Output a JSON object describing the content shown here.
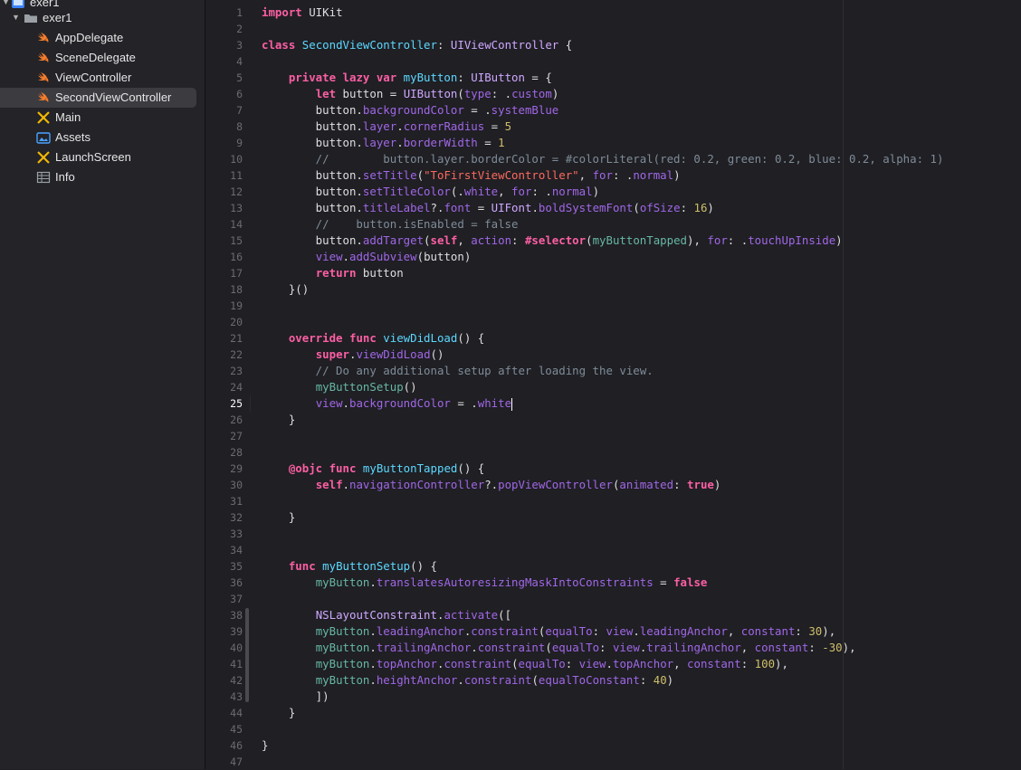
{
  "sidebar": {
    "items": [
      {
        "label": "exer1",
        "icon": "xcode-project-icon",
        "kind": "project"
      },
      {
        "label": "exer1",
        "icon": "folder-icon",
        "kind": "group"
      },
      {
        "label": "AppDelegate",
        "icon": "swift-file-icon"
      },
      {
        "label": "SceneDelegate",
        "icon": "swift-file-icon"
      },
      {
        "label": "ViewController",
        "icon": "swift-file-icon"
      },
      {
        "label": "SecondViewController",
        "icon": "swift-file-icon",
        "selected": true
      },
      {
        "label": "Main",
        "icon": "storyboard-icon"
      },
      {
        "label": "Assets",
        "icon": "asset-catalog-icon"
      },
      {
        "label": "LaunchScreen",
        "icon": "storyboard-icon"
      },
      {
        "label": "Info",
        "icon": "plist-icon"
      }
    ]
  },
  "editor": {
    "current_line": 25,
    "line_count": 47,
    "lines": [
      [
        [
          "kw",
          "import"
        ],
        [
          "pl",
          " UIKit"
        ]
      ],
      [],
      [
        [
          "kw",
          "class"
        ],
        [
          "pl",
          " "
        ],
        [
          "ty",
          "SecondViewController"
        ],
        [
          "pl",
          ": "
        ],
        [
          "tyd",
          "UIViewController"
        ],
        [
          "pl",
          " {"
        ]
      ],
      [],
      [
        [
          "pl",
          "    "
        ],
        [
          "kw",
          "private lazy var"
        ],
        [
          "pl",
          " "
        ],
        [
          "ty",
          "myButton"
        ],
        [
          "pl",
          ": "
        ],
        [
          "tyd",
          "UIButton"
        ],
        [
          "pl",
          " = {"
        ]
      ],
      [
        [
          "pl",
          "        "
        ],
        [
          "kw",
          "let"
        ],
        [
          "pl",
          " button = "
        ],
        [
          "tyd",
          "UIButton"
        ],
        [
          "pl",
          "("
        ],
        [
          "pr",
          "type"
        ],
        [
          "pl",
          ": ."
        ],
        [
          "pr",
          "custom"
        ],
        [
          "pl",
          ")"
        ]
      ],
      [
        [
          "pl",
          "        button."
        ],
        [
          "pr",
          "backgroundColor"
        ],
        [
          "pl",
          " = ."
        ],
        [
          "pr",
          "systemBlue"
        ]
      ],
      [
        [
          "pl",
          "        button."
        ],
        [
          "pr",
          "layer"
        ],
        [
          "pl",
          "."
        ],
        [
          "pr",
          "cornerRadius"
        ],
        [
          "pl",
          " = "
        ],
        [
          "num",
          "5"
        ]
      ],
      [
        [
          "pl",
          "        button."
        ],
        [
          "pr",
          "layer"
        ],
        [
          "pl",
          "."
        ],
        [
          "pr",
          "borderWidth"
        ],
        [
          "pl",
          " = "
        ],
        [
          "num",
          "1"
        ]
      ],
      [
        [
          "cm",
          "        //        button.layer.borderColor = #colorLiteral(red: 0.2, green: 0.2, blue: 0.2, alpha: 1)"
        ]
      ],
      [
        [
          "pl",
          "        button."
        ],
        [
          "pr",
          "setTitle"
        ],
        [
          "pl",
          "("
        ],
        [
          "str",
          "\"ToFirstViewController\""
        ],
        [
          "pl",
          ", "
        ],
        [
          "pr",
          "for"
        ],
        [
          "pl",
          ": ."
        ],
        [
          "pr",
          "normal"
        ],
        [
          "pl",
          ")"
        ]
      ],
      [
        [
          "pl",
          "        button."
        ],
        [
          "pr",
          "setTitleColor"
        ],
        [
          "pl",
          "(."
        ],
        [
          "pr",
          "white"
        ],
        [
          "pl",
          ", "
        ],
        [
          "pr",
          "for"
        ],
        [
          "pl",
          ": ."
        ],
        [
          "pr",
          "normal"
        ],
        [
          "pl",
          ")"
        ]
      ],
      [
        [
          "pl",
          "        button."
        ],
        [
          "pr",
          "titleLabel"
        ],
        [
          "pl",
          "?."
        ],
        [
          "pr",
          "font"
        ],
        [
          "pl",
          " = "
        ],
        [
          "tyd",
          "UIFont"
        ],
        [
          "pl",
          "."
        ],
        [
          "pr",
          "boldSystemFont"
        ],
        [
          "pl",
          "("
        ],
        [
          "pr",
          "ofSize"
        ],
        [
          "pl",
          ": "
        ],
        [
          "num",
          "16"
        ],
        [
          "pl",
          ")"
        ]
      ],
      [
        [
          "cm",
          "        //    button.isEnabled = false"
        ]
      ],
      [
        [
          "pl",
          "        button."
        ],
        [
          "pr",
          "addTarget"
        ],
        [
          "pl",
          "("
        ],
        [
          "kw",
          "self"
        ],
        [
          "pl",
          ", "
        ],
        [
          "pr",
          "action"
        ],
        [
          "pl",
          ": "
        ],
        [
          "kw",
          "#selector"
        ],
        [
          "pl",
          "("
        ],
        [
          "fn",
          "myButtonTapped"
        ],
        [
          "pl",
          "), "
        ],
        [
          "pr",
          "for"
        ],
        [
          "pl",
          ": ."
        ],
        [
          "pr",
          "touchUpInside"
        ],
        [
          "pl",
          ")"
        ]
      ],
      [
        [
          "pl",
          "        "
        ],
        [
          "pr",
          "view"
        ],
        [
          "pl",
          "."
        ],
        [
          "pr",
          "addSubview"
        ],
        [
          "pl",
          "(button)"
        ]
      ],
      [
        [
          "pl",
          "        "
        ],
        [
          "kw",
          "return"
        ],
        [
          "pl",
          " button"
        ]
      ],
      [
        [
          "pl",
          "    }()"
        ]
      ],
      [],
      [],
      [
        [
          "pl",
          "    "
        ],
        [
          "kw",
          "override func"
        ],
        [
          "pl",
          " "
        ],
        [
          "ty",
          "viewDidLoad"
        ],
        [
          "pl",
          "() {"
        ]
      ],
      [
        [
          "pl",
          "        "
        ],
        [
          "kw",
          "super"
        ],
        [
          "pl",
          "."
        ],
        [
          "pr",
          "viewDidLoad"
        ],
        [
          "pl",
          "()"
        ]
      ],
      [
        [
          "cm",
          "        // Do any additional setup after loading the view."
        ]
      ],
      [
        [
          "pl",
          "        "
        ],
        [
          "fn",
          "myButtonSetup"
        ],
        [
          "pl",
          "()"
        ]
      ],
      [
        [
          "pl",
          "        "
        ],
        [
          "pr",
          "view"
        ],
        [
          "pl",
          "."
        ],
        [
          "pr",
          "backgroundColor"
        ],
        [
          "pl",
          " = ."
        ],
        [
          "pr",
          "white"
        ]
      ],
      [
        [
          "pl",
          "    }"
        ]
      ],
      [],
      [],
      [
        [
          "pl",
          "    "
        ],
        [
          "kw",
          "@objc func"
        ],
        [
          "pl",
          " "
        ],
        [
          "ty",
          "myButtonTapped"
        ],
        [
          "pl",
          "() {"
        ]
      ],
      [
        [
          "pl",
          "        "
        ],
        [
          "kw",
          "self"
        ],
        [
          "pl",
          "."
        ],
        [
          "pr",
          "navigationController"
        ],
        [
          "pl",
          "?."
        ],
        [
          "pr",
          "popViewController"
        ],
        [
          "pl",
          "("
        ],
        [
          "pr",
          "animated"
        ],
        [
          "pl",
          ": "
        ],
        [
          "kw",
          "true"
        ],
        [
          "pl",
          ")"
        ]
      ],
      [],
      [
        [
          "pl",
          "    }"
        ]
      ],
      [],
      [],
      [
        [
          "pl",
          "    "
        ],
        [
          "kw",
          "func"
        ],
        [
          "pl",
          " "
        ],
        [
          "ty",
          "myButtonSetup"
        ],
        [
          "pl",
          "() {"
        ]
      ],
      [
        [
          "pl",
          "        "
        ],
        [
          "fn",
          "myButton"
        ],
        [
          "pl",
          "."
        ],
        [
          "pr",
          "translatesAutoresizingMaskIntoConstraints"
        ],
        [
          "pl",
          " = "
        ],
        [
          "kw",
          "false"
        ]
      ],
      [],
      [
        [
          "pl",
          "        "
        ],
        [
          "tyd",
          "NSLayoutConstraint"
        ],
        [
          "pl",
          "."
        ],
        [
          "pr",
          "activate"
        ],
        [
          "pl",
          "(["
        ]
      ],
      [
        [
          "pl",
          "        "
        ],
        [
          "fn",
          "myButton"
        ],
        [
          "pl",
          "."
        ],
        [
          "pr",
          "leadingAnchor"
        ],
        [
          "pl",
          "."
        ],
        [
          "pr",
          "constraint"
        ],
        [
          "pl",
          "("
        ],
        [
          "pr",
          "equalTo"
        ],
        [
          "pl",
          ": "
        ],
        [
          "pr",
          "view"
        ],
        [
          "pl",
          "."
        ],
        [
          "pr",
          "leadingAnchor"
        ],
        [
          "pl",
          ", "
        ],
        [
          "pr",
          "constant"
        ],
        [
          "pl",
          ": "
        ],
        [
          "num",
          "30"
        ],
        [
          "pl",
          "),"
        ]
      ],
      [
        [
          "pl",
          "        "
        ],
        [
          "fn",
          "myButton"
        ],
        [
          "pl",
          "."
        ],
        [
          "pr",
          "trailingAnchor"
        ],
        [
          "pl",
          "."
        ],
        [
          "pr",
          "constraint"
        ],
        [
          "pl",
          "("
        ],
        [
          "pr",
          "equalTo"
        ],
        [
          "pl",
          ": "
        ],
        [
          "pr",
          "view"
        ],
        [
          "pl",
          "."
        ],
        [
          "pr",
          "trailingAnchor"
        ],
        [
          "pl",
          ", "
        ],
        [
          "pr",
          "constant"
        ],
        [
          "pl",
          ": "
        ],
        [
          "num",
          "-30"
        ],
        [
          "pl",
          "),"
        ]
      ],
      [
        [
          "pl",
          "        "
        ],
        [
          "fn",
          "myButton"
        ],
        [
          "pl",
          "."
        ],
        [
          "pr",
          "topAnchor"
        ],
        [
          "pl",
          "."
        ],
        [
          "pr",
          "constraint"
        ],
        [
          "pl",
          "("
        ],
        [
          "pr",
          "equalTo"
        ],
        [
          "pl",
          ": "
        ],
        [
          "pr",
          "view"
        ],
        [
          "pl",
          "."
        ],
        [
          "pr",
          "topAnchor"
        ],
        [
          "pl",
          ", "
        ],
        [
          "pr",
          "constant"
        ],
        [
          "pl",
          ": "
        ],
        [
          "num",
          "100"
        ],
        [
          "pl",
          "),"
        ]
      ],
      [
        [
          "pl",
          "        "
        ],
        [
          "fn",
          "myButton"
        ],
        [
          "pl",
          "."
        ],
        [
          "pr",
          "heightAnchor"
        ],
        [
          "pl",
          "."
        ],
        [
          "pr",
          "constraint"
        ],
        [
          "pl",
          "("
        ],
        [
          "pr",
          "equalToConstant"
        ],
        [
          "pl",
          ": "
        ],
        [
          "num",
          "40"
        ],
        [
          "pl",
          ")"
        ]
      ],
      [
        [
          "pl",
          "        ])"
        ]
      ],
      [
        [
          "pl",
          "    }"
        ]
      ],
      [],
      [
        [
          "pl",
          "}"
        ]
      ],
      []
    ]
  }
}
